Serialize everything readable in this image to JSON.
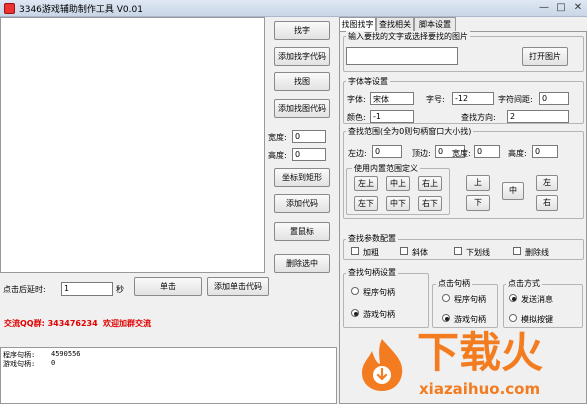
{
  "window": {
    "title": "3346游戏辅助制作工具 V0.01",
    "minimize": "—",
    "maximize": "□",
    "close": "✕"
  },
  "left_buttons": {
    "find_text": "找字",
    "add_find_text_code": "添加找字代码",
    "find_image": "找图",
    "add_find_image_code": "添加找图代码",
    "coord_to_rect": "坐标到矩形",
    "add_code": "添加代码",
    "set_mouse": "置鼠标",
    "delete_selected": "删除选中"
  },
  "size": {
    "width_label": "宽度:",
    "width_value": "0",
    "height_label": "高度:",
    "height_value": "0"
  },
  "click_row": {
    "delay_label": "点击后延时:",
    "delay_value": "1",
    "unit": "秒",
    "click_button": "单击",
    "add_click_code_button": "添加单击代码"
  },
  "promo": {
    "qq_group": "交流QQ群: 343476234",
    "welcome": "欢迎加群交流"
  },
  "log": {
    "line1_label": "程序句柄:",
    "line1_value": "4590556",
    "line2_label": "游戏句柄:",
    "line2_value": "0"
  },
  "tabs": [
    "找图找字",
    "查找相关",
    "脚本设置"
  ],
  "search": {
    "group_title": "输入要找的文字或选择要找的图片",
    "input_value": "",
    "open_image_button": "打开图片"
  },
  "font_settings": {
    "title": "字体等设置",
    "font_label": "字体:",
    "font_value": "宋体",
    "size_label": "字号:",
    "size_value": "-12",
    "spacing_label": "字符间距:",
    "spacing_value": "0",
    "color_label": "颜色:",
    "color_value": "-1",
    "direction_label": "查找方向:",
    "direction_value": "2"
  },
  "range": {
    "title": "查找范围(全为0则句柄窗口大小找)",
    "left_label": "左边:",
    "left_value": "0",
    "top_label": "顶边:",
    "top_value": "0",
    "width_label": "宽度:",
    "width_value": "0",
    "height_label": "高度:",
    "height_value": "0",
    "builtin_title": "使用内置范围定义",
    "btn_top_left": "左上",
    "btn_middle_top": "中上",
    "btn_top_right": "右上",
    "btn_bottom_left": "左下",
    "btn_middle_bottom": "中下",
    "btn_bottom_right": "右下",
    "btn_up": "上",
    "btn_down": "下",
    "btn_center": "中",
    "btn_left": "左",
    "btn_right": "右"
  },
  "params": {
    "title": "查找参数配置",
    "bold": "加粗",
    "italic": "斜体",
    "underline": "下划线",
    "strike": "删除线"
  },
  "handle": {
    "title": "查找句柄设置",
    "program": "程序句柄",
    "game": "游戏句柄"
  },
  "click_handle": {
    "title": "点击句柄",
    "program": "程序句柄",
    "game": "游戏句柄"
  },
  "click_method": {
    "title": "点击方式",
    "send_message": "发送消息",
    "simulate_key": "模拟按键"
  },
  "watermark": {
    "brand": "下载火",
    "domain": "xiazaihuo.com"
  },
  "colors": {
    "promo_red": "#e00000",
    "watermark_orange": "#f47c20"
  }
}
